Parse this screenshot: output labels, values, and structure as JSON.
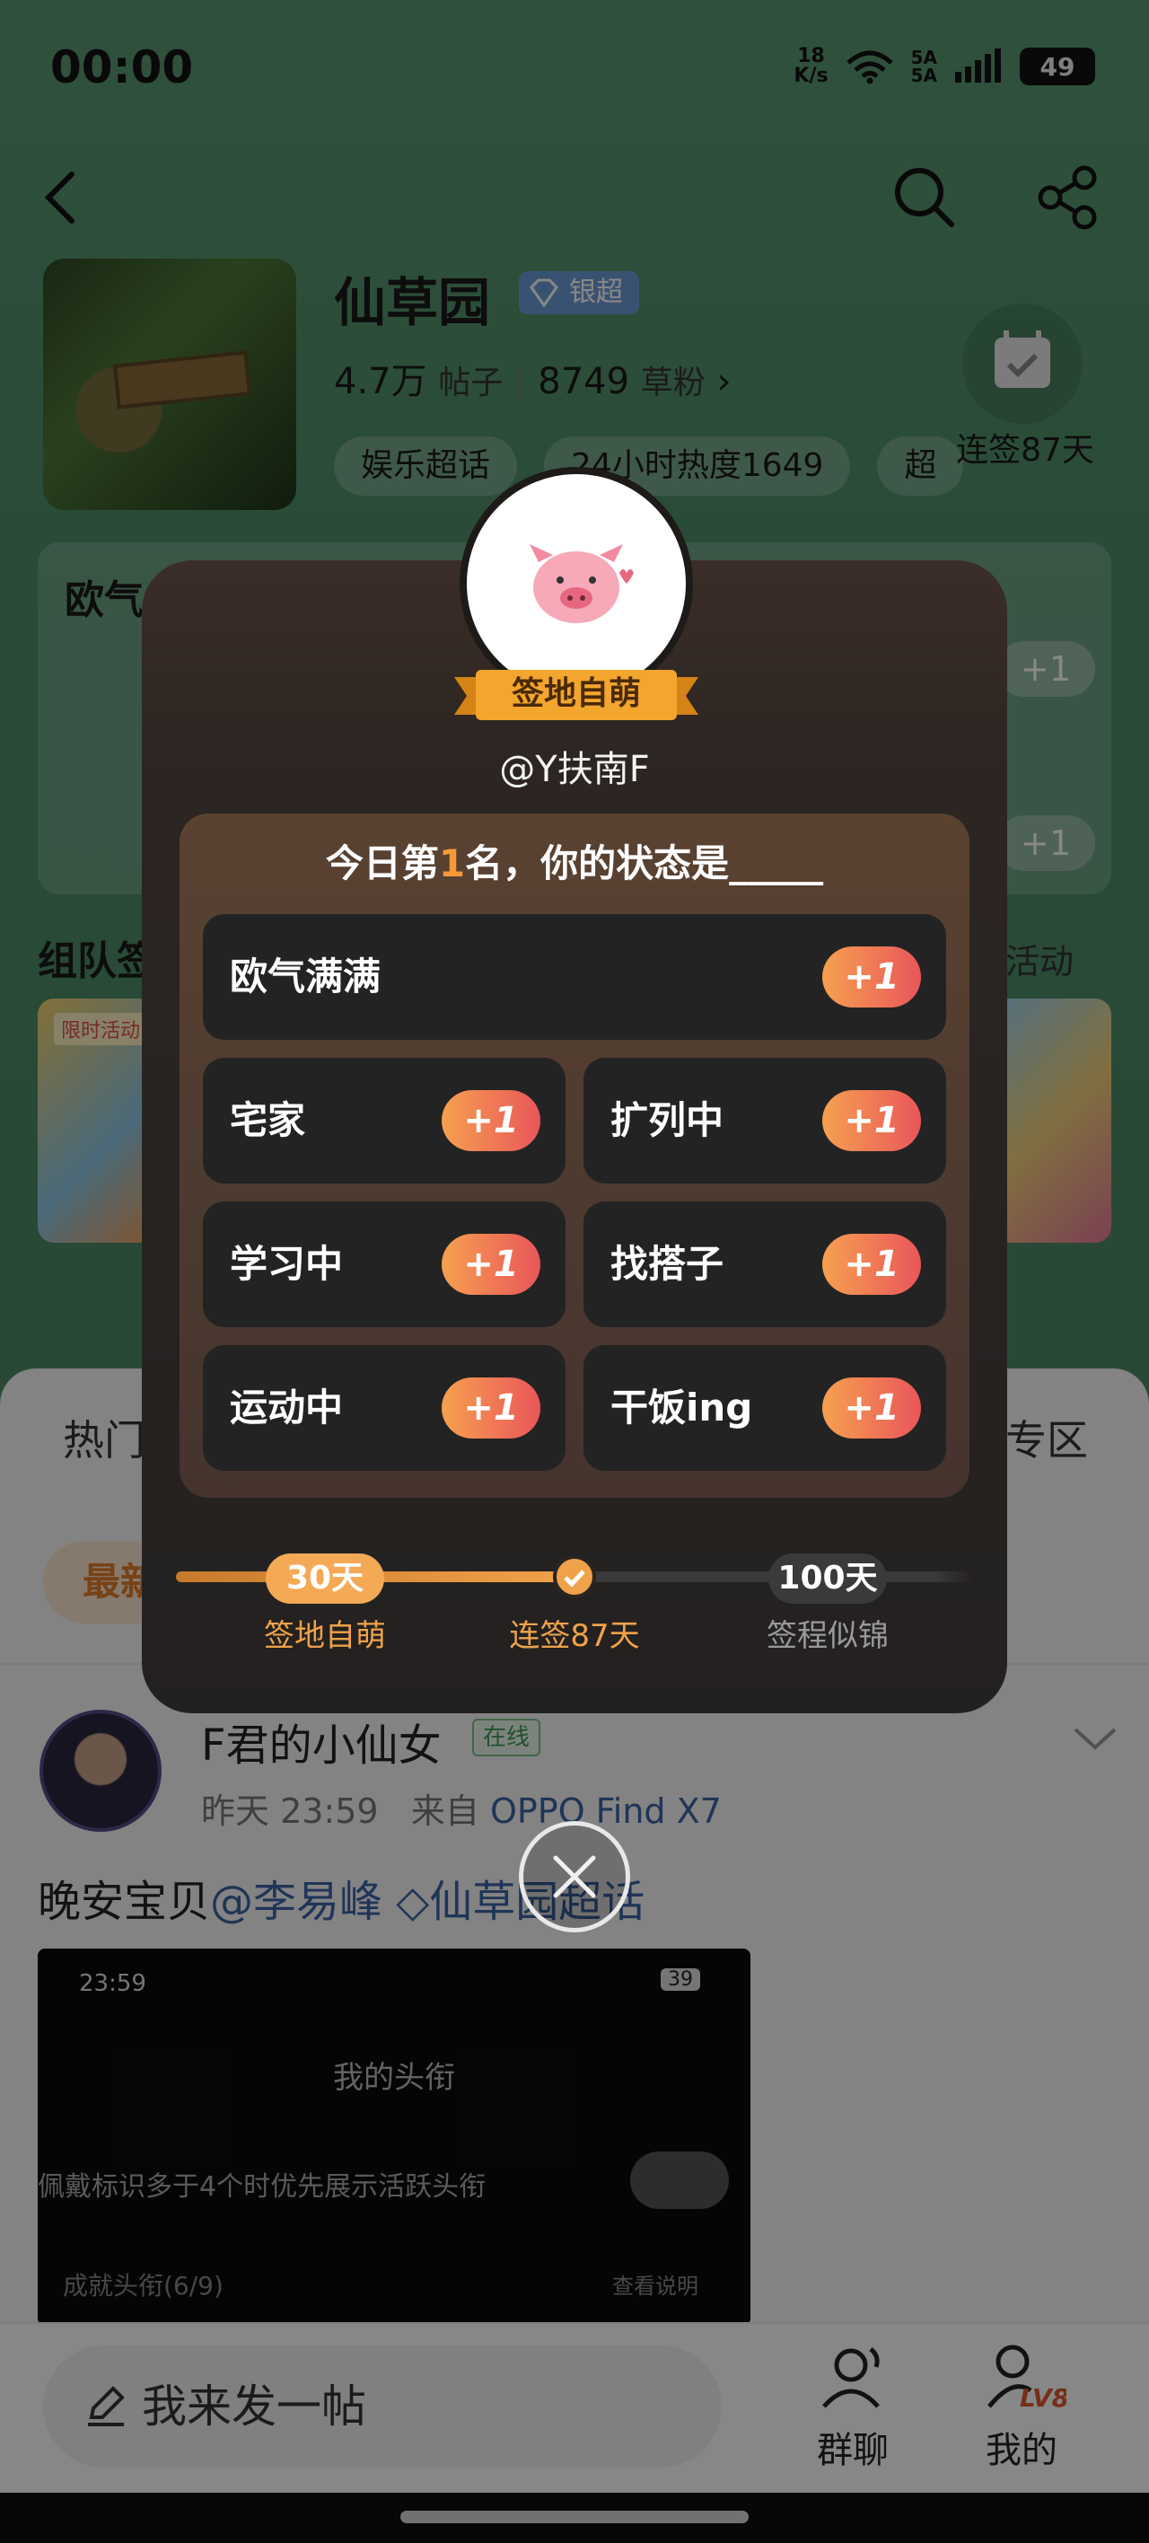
{
  "status_bar": {
    "time": "00:00",
    "net_speed_value": "18",
    "net_speed_unit": "K/s",
    "sim_label_1": "5A",
    "sim_label_2": "5A",
    "battery": "49"
  },
  "header": {
    "name": "仙草园",
    "badge": "银超",
    "posts_count": "4.7万",
    "posts_unit": "帖子",
    "fans_count": "8749",
    "fans_unit": "草粉",
    "chips": [
      "娱乐超话",
      "24小时热度1649",
      "超"
    ],
    "checkin_label": "连签87天"
  },
  "under": {
    "card_text": "欧气",
    "plus": "+1",
    "team_title": "组队签",
    "activity_link": "活动",
    "promo_tag": "限时活动",
    "sheet_tab_left": "热门",
    "sheet_tab_right": "专区",
    "latest": "最新",
    "post": {
      "author": "F君的小仙女",
      "online": "在线",
      "time": "昨天 23:59",
      "from": "来自",
      "device": "OPPO Find X7",
      "text_prefix": "晚安宝贝",
      "mention": "@李易峰",
      "topic": "仙草园超话",
      "embed": {
        "time": "23:59",
        "battery": "39",
        "title": "我的头衔",
        "setting_row": "佩戴标识多于4个时优先展示活跃头衔",
        "achievements": "成就头衔(6/9)",
        "help": "查看说明"
      }
    },
    "compose_placeholder": "我来发一帖",
    "nav_group": "群聊",
    "nav_me": "我的",
    "level": "LV8"
  },
  "modal": {
    "title_ribbon": "签地自萌",
    "username": "@Y扶南F",
    "prompt_prefix": "今日第",
    "prompt_rank": "1",
    "prompt_suffix": "名，你的状态是_____",
    "options": [
      {
        "label": "欧气满满",
        "plus": "+1"
      },
      {
        "label": "宅家",
        "plus": "+1"
      },
      {
        "label": "扩列中",
        "plus": "+1"
      },
      {
        "label": "学习中",
        "plus": "+1"
      },
      {
        "label": "找搭子",
        "plus": "+1"
      },
      {
        "label": "运动中",
        "plus": "+1"
      },
      {
        "label": "干饭ing",
        "plus": "+1"
      }
    ],
    "progress": {
      "current_days": 87,
      "milestones": [
        {
          "days": "30天",
          "label": "签地自萌",
          "reached": true
        },
        {
          "days": "",
          "label": "连签87天",
          "reached": true
        },
        {
          "days": "100天",
          "label": "签程似锦",
          "reached": false
        }
      ]
    }
  },
  "colors": {
    "header_green": "#4f8d68",
    "accent_orange": "#f0a24a",
    "plus_gradient_start": "#f6a050",
    "plus_gradient_end": "#e9565a",
    "link_blue": "#3c64a5"
  }
}
